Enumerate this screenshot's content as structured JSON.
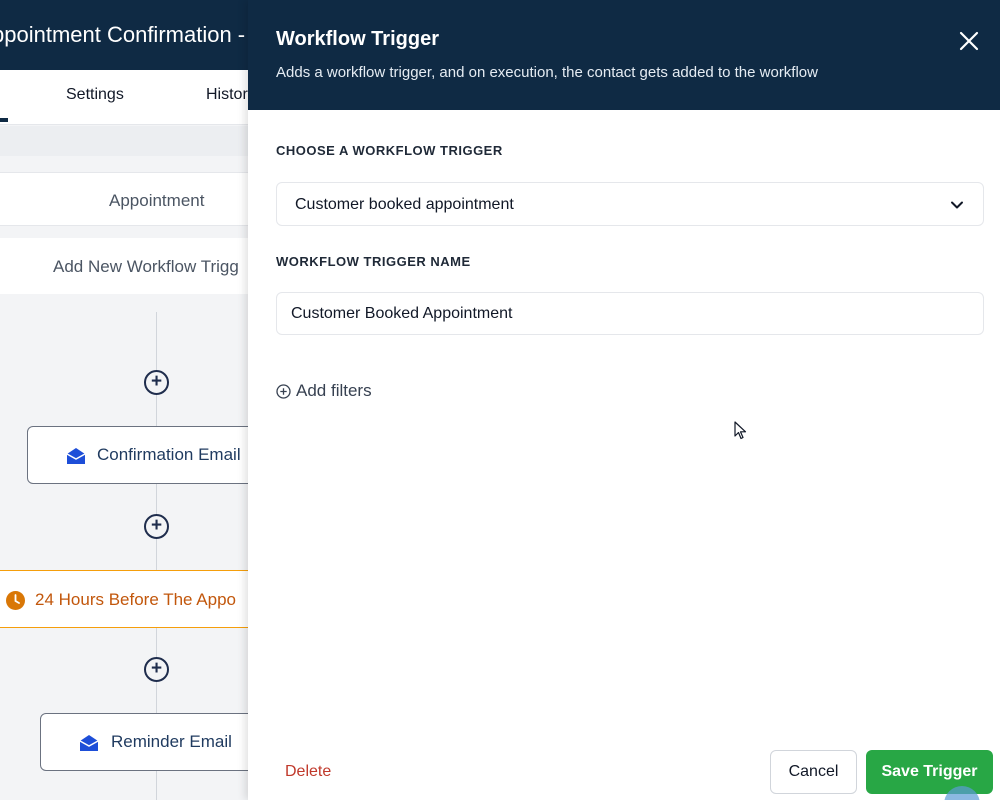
{
  "background": {
    "title": "ppointment Confirmation -",
    "tabs": [
      {
        "label": "Settings"
      },
      {
        "label": "Histor"
      }
    ],
    "trigger_card": {
      "label": "Appointment"
    },
    "add_trigger_card": {
      "label": "Add New Workflow Trigg"
    },
    "steps": [
      {
        "type": "email",
        "label": "Confirmation Email",
        "icon": "mail-icon"
      },
      {
        "type": "wait",
        "label": "24 Hours Before The Appo",
        "icon": "clock-icon"
      },
      {
        "type": "email",
        "label": "Reminder Email",
        "icon": "mail-icon"
      }
    ]
  },
  "drawer": {
    "title": "Workflow Trigger",
    "subtitle": "Adds a workflow trigger, and on execution, the contact gets added to the workflow",
    "trigger_select": {
      "label": "CHOOSE A WORKFLOW TRIGGER",
      "value": "Customer booked appointment"
    },
    "trigger_name": {
      "label": "WORKFLOW TRIGGER NAME",
      "value": "Customer Booked Appointment"
    },
    "add_filters_label": "Add filters",
    "footer": {
      "delete_label": "Delete",
      "cancel_label": "Cancel",
      "save_label": "Save Trigger"
    }
  },
  "colors": {
    "header_bg": "#0f2a44",
    "save_button": "#28a745",
    "delete_text": "#c0392b",
    "wait_step_accent": "#d97706",
    "email_icon": "#1d4ed8"
  }
}
